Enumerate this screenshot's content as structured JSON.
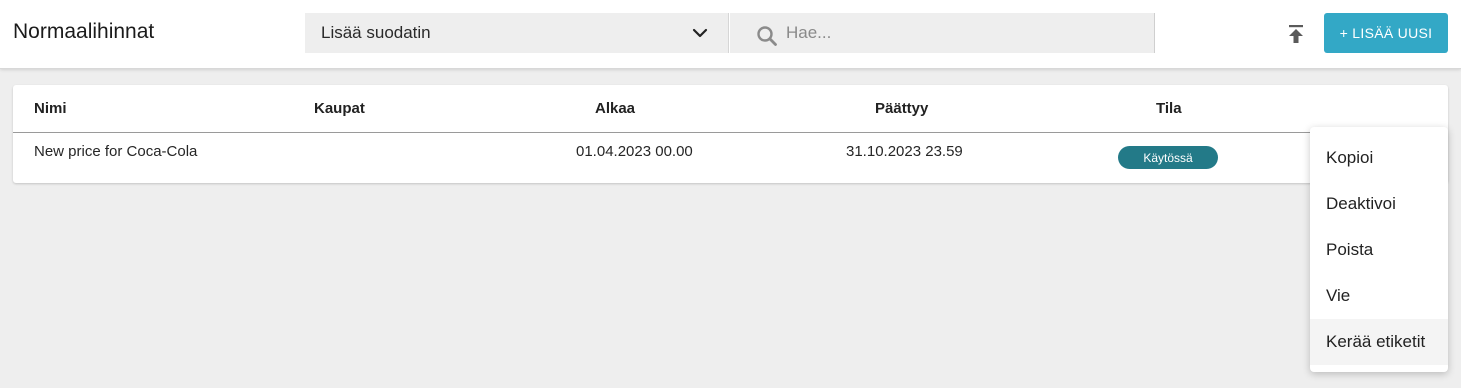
{
  "header": {
    "title": "Normaalihinnat",
    "filter_label": "Lisää suodatin",
    "search_placeholder": "Hae...",
    "add_button_label": "+ LISÄÄ UUSI",
    "accent_color": "#33a8c6"
  },
  "table": {
    "columns": [
      "Nimi",
      "Kaupat",
      "Alkaa",
      "Päättyy",
      "Tila"
    ],
    "rows": [
      {
        "name": "New price for Coca-Cola",
        "stores": "",
        "start": "01.04.2023 00.00",
        "end": "31.10.2023 23.59",
        "status": "Käytössä",
        "status_color": "#237a88"
      }
    ]
  },
  "context_menu": {
    "items": [
      "Kopioi",
      "Deaktivoi",
      "Poista",
      "Vie",
      "Kerää etiketit"
    ],
    "highlighted": "Kerää etiketit"
  },
  "icons": [
    "chevron-down-icon",
    "search-icon",
    "upload-icon"
  ]
}
